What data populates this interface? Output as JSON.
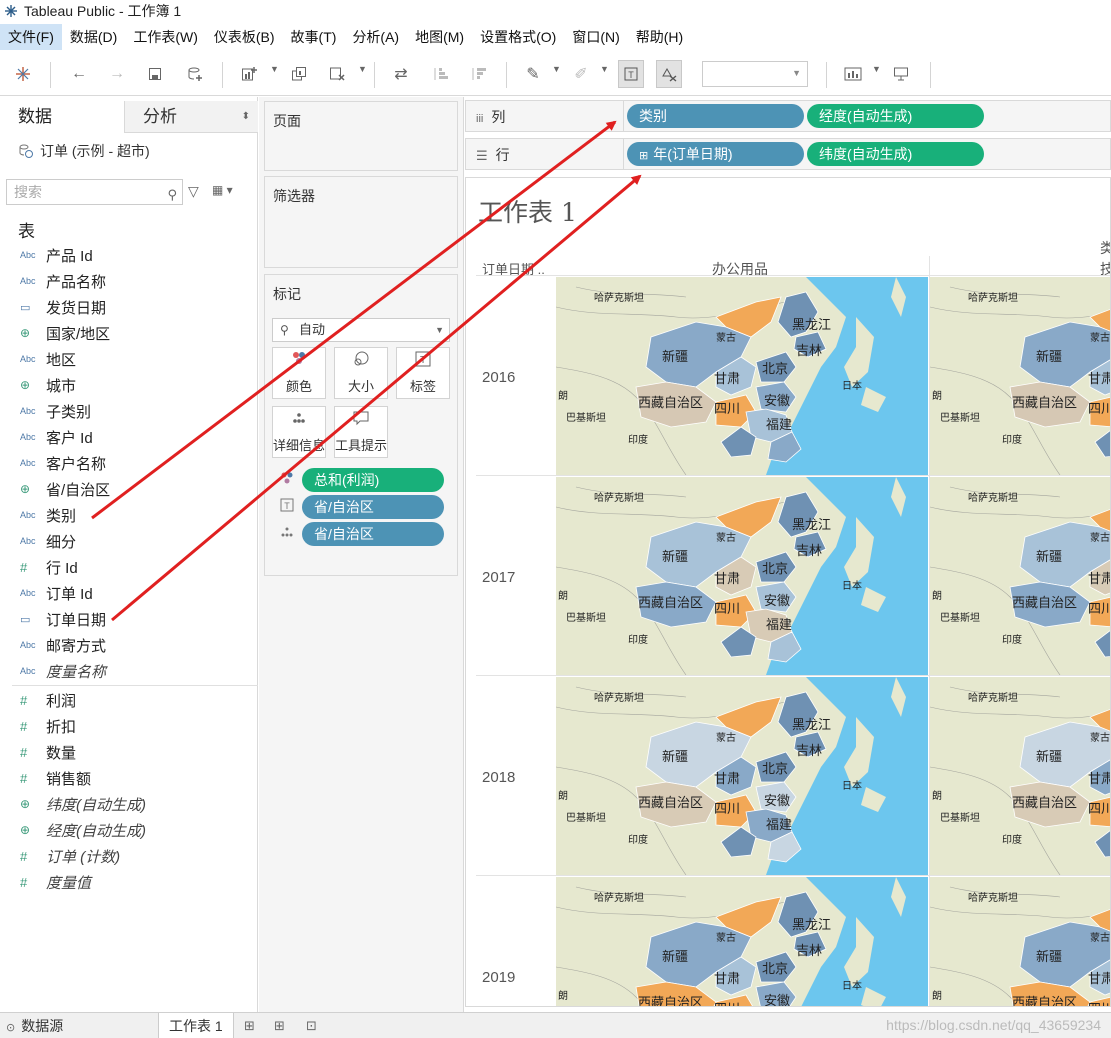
{
  "window": {
    "title": "Tableau Public - 工作簿 1"
  },
  "menu": [
    "文件(F)",
    "数据(D)",
    "工作表(W)",
    "仪表板(B)",
    "故事(T)",
    "分析(A)",
    "地图(M)",
    "设置格式(O)",
    "窗口(N)",
    "帮助(H)"
  ],
  "left": {
    "tabs": {
      "data": "数据",
      "analysis": "分析"
    },
    "datasource": "订单 (示例 - 超市)",
    "search_placeholder": "搜索",
    "section": "表",
    "dimensions": [
      {
        "icon": "Abc",
        "label": "产品 Id"
      },
      {
        "icon": "Abc",
        "label": "产品名称"
      },
      {
        "icon": "calendar",
        "label": "发货日期"
      },
      {
        "icon": "globe",
        "label": "国家/地区"
      },
      {
        "icon": "Abc",
        "label": "地区"
      },
      {
        "icon": "globe",
        "label": "城市"
      },
      {
        "icon": "Abc",
        "label": "子类别"
      },
      {
        "icon": "Abc",
        "label": "客户 Id"
      },
      {
        "icon": "Abc",
        "label": "客户名称"
      },
      {
        "icon": "globe",
        "label": "省/自治区"
      },
      {
        "icon": "Abc",
        "label": "类别"
      },
      {
        "icon": "Abc",
        "label": "细分"
      },
      {
        "icon": "#",
        "label": "行 Id"
      },
      {
        "icon": "Abc",
        "label": "订单 Id"
      },
      {
        "icon": "calendar",
        "label": "订单日期"
      },
      {
        "icon": "Abc",
        "label": "邮寄方式"
      },
      {
        "icon": "Abc",
        "label": "度量名称",
        "italic": true
      }
    ],
    "measures": [
      {
        "icon": "#",
        "label": "利润"
      },
      {
        "icon": "#",
        "label": "折扣"
      },
      {
        "icon": "#",
        "label": "数量"
      },
      {
        "icon": "#",
        "label": "销售额"
      },
      {
        "icon": "globe",
        "label": "纬度(自动生成)",
        "italic": true
      },
      {
        "icon": "globe",
        "label": "经度(自动生成)",
        "italic": true
      },
      {
        "icon": "#",
        "label": "订单 (计数)",
        "italic": true
      },
      {
        "icon": "#",
        "label": "度量值",
        "italic": true
      }
    ]
  },
  "cards": {
    "pages": "页面",
    "filters": "筛选器",
    "marks": "标记",
    "mark_type": "自动",
    "mark_buttons": [
      "颜色",
      "大小",
      "标签",
      "详细信息",
      "工具提示"
    ],
    "mark_pills": [
      "总和(利润)",
      "省/自治区",
      "省/自治区"
    ]
  },
  "shelves": {
    "columns_label": "列",
    "rows_label": "行",
    "columns_pills": [
      "类别",
      "经度(自动生成)"
    ],
    "rows_pills": [
      "年(订单日期)",
      "纬度(自动生成)"
    ]
  },
  "view": {
    "sheet_title": "工作表 1",
    "row_header": "订单日期 ..",
    "col_headers": [
      "办公用品",
      "技"
    ],
    "col_header_top_partial": "类",
    "years": [
      "2016",
      "2017",
      "2018",
      "2019"
    ],
    "map_labels": {
      "kazakhstan": "哈萨克斯坦",
      "mongolia": "蒙古",
      "xinjiang": "新疆",
      "heilongjiang": "黑龙江",
      "jilin": "吉林",
      "gansu": "甘肃",
      "beijing": "北京",
      "tibet": "西藏自治区",
      "sichuan": "四川",
      "anhui": "安徽",
      "fujian": "福建",
      "india": "印度",
      "japan": "日本",
      "pakistan": "巴基斯坦",
      "iran": "朗"
    }
  },
  "bottom": {
    "datasource_tab": "数据源",
    "sheet_tab": "工作表 1",
    "watermark": "https://blog.csdn.net/qq_43659234"
  }
}
